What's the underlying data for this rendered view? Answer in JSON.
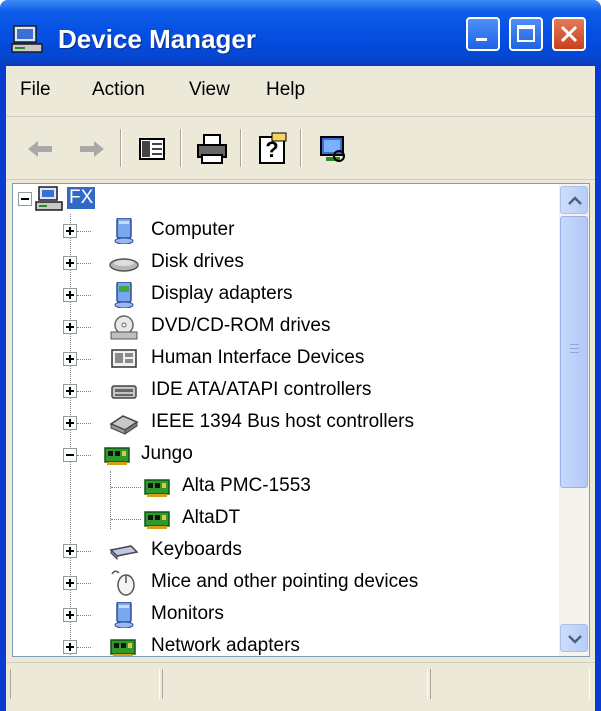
{
  "window": {
    "title": "Device Manager"
  },
  "menu": [
    {
      "label": "File"
    },
    {
      "label": "Action"
    },
    {
      "label": "View"
    },
    {
      "label": "Help"
    }
  ],
  "toolbar": [
    {
      "icon": "back-arrow-icon"
    },
    {
      "icon": "forward-arrow-icon"
    },
    {
      "icon": "show-hide-console-tree-icon"
    },
    {
      "icon": "print-icon"
    },
    {
      "icon": "help-icon"
    },
    {
      "icon": "scan-hardware-icon"
    }
  ],
  "tree": {
    "root": {
      "label": "FX",
      "expanded": true,
      "selected": true,
      "icon": "computer-icon"
    },
    "items": [
      {
        "label": "Computer",
        "icon": "computer-monitor-icon",
        "expanded": false,
        "level": 1
      },
      {
        "label": "Disk drives",
        "icon": "disk-drive-icon",
        "expanded": false,
        "level": 1
      },
      {
        "label": "Display adapters",
        "icon": "display-adapter-icon",
        "expanded": false,
        "level": 1
      },
      {
        "label": "DVD/CD-ROM drives",
        "icon": "dvd-drive-icon",
        "expanded": false,
        "level": 1
      },
      {
        "label": "Human Interface Devices",
        "icon": "hid-icon",
        "expanded": false,
        "level": 1
      },
      {
        "label": "IDE ATA/ATAPI controllers",
        "icon": "ide-controller-icon",
        "expanded": false,
        "level": 1
      },
      {
        "label": "IEEE 1394 Bus host controllers",
        "icon": "ieee1394-icon",
        "expanded": false,
        "level": 1
      },
      {
        "label": "Jungo",
        "icon": "circuit-board-icon",
        "expanded": true,
        "level": 1
      },
      {
        "label": "Alta PMC-1553",
        "icon": "circuit-board-icon",
        "level": 2
      },
      {
        "label": "AltaDT",
        "icon": "circuit-board-icon",
        "level": 2
      },
      {
        "label": "Keyboards",
        "icon": "keyboard-icon",
        "expanded": false,
        "level": 1
      },
      {
        "label": "Mice and other pointing devices",
        "icon": "mouse-icon",
        "expanded": false,
        "level": 1
      },
      {
        "label": "Monitors",
        "icon": "monitor-icon",
        "expanded": false,
        "level": 1
      },
      {
        "label": "Network adapters",
        "icon": "network-adapter-icon",
        "expanded": false,
        "level": 1
      }
    ]
  },
  "colors": {
    "titlebar": "#0550e3",
    "selection": "#316ac5",
    "chrome": "#ece9d8"
  }
}
